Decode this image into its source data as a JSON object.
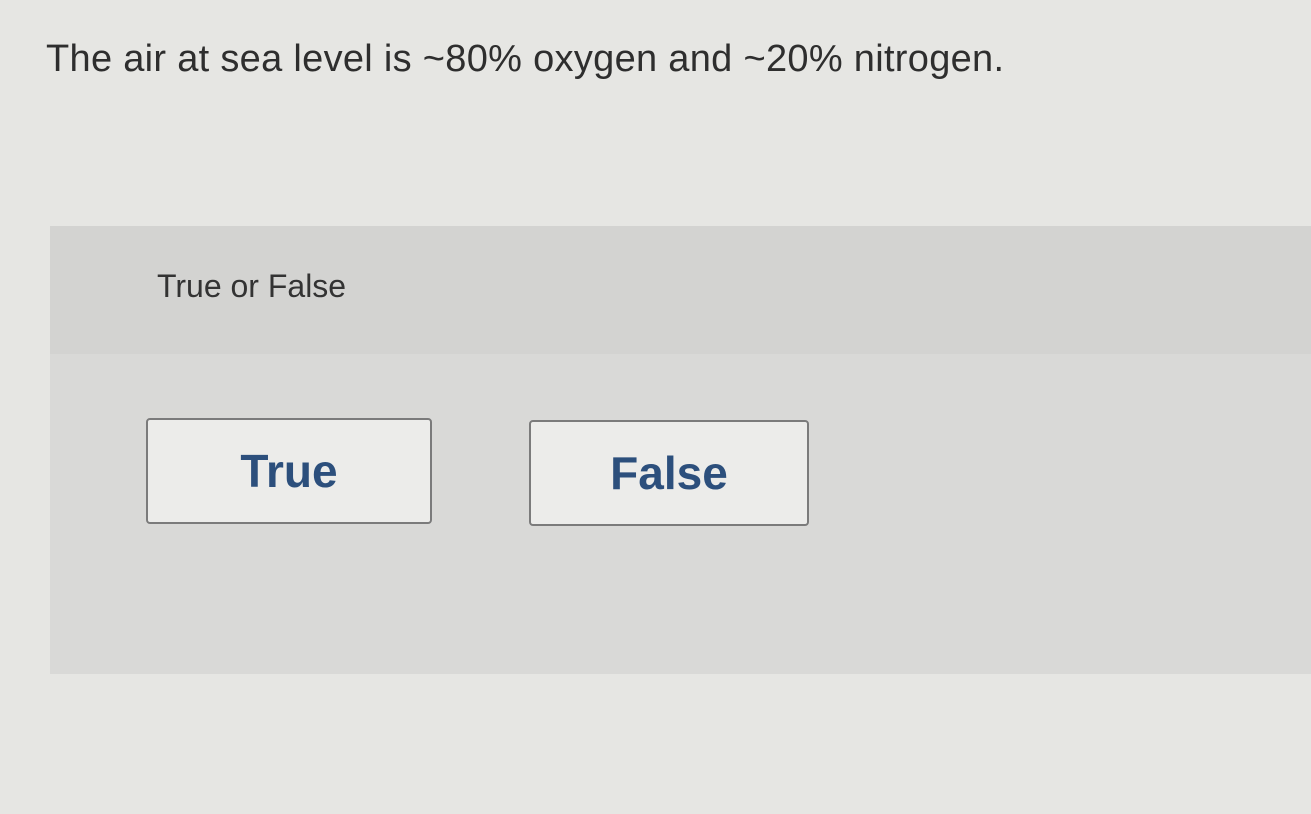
{
  "question": {
    "text": "The air at sea level is ~80% oxygen and ~20% nitrogen."
  },
  "answer_panel": {
    "instruction": "True or False",
    "options": [
      {
        "label": "True"
      },
      {
        "label": "False"
      }
    ]
  },
  "colors": {
    "button_text": "#2c4f7c",
    "page_background": "#e6e6e3",
    "panel_background": "#d9d9d7"
  }
}
